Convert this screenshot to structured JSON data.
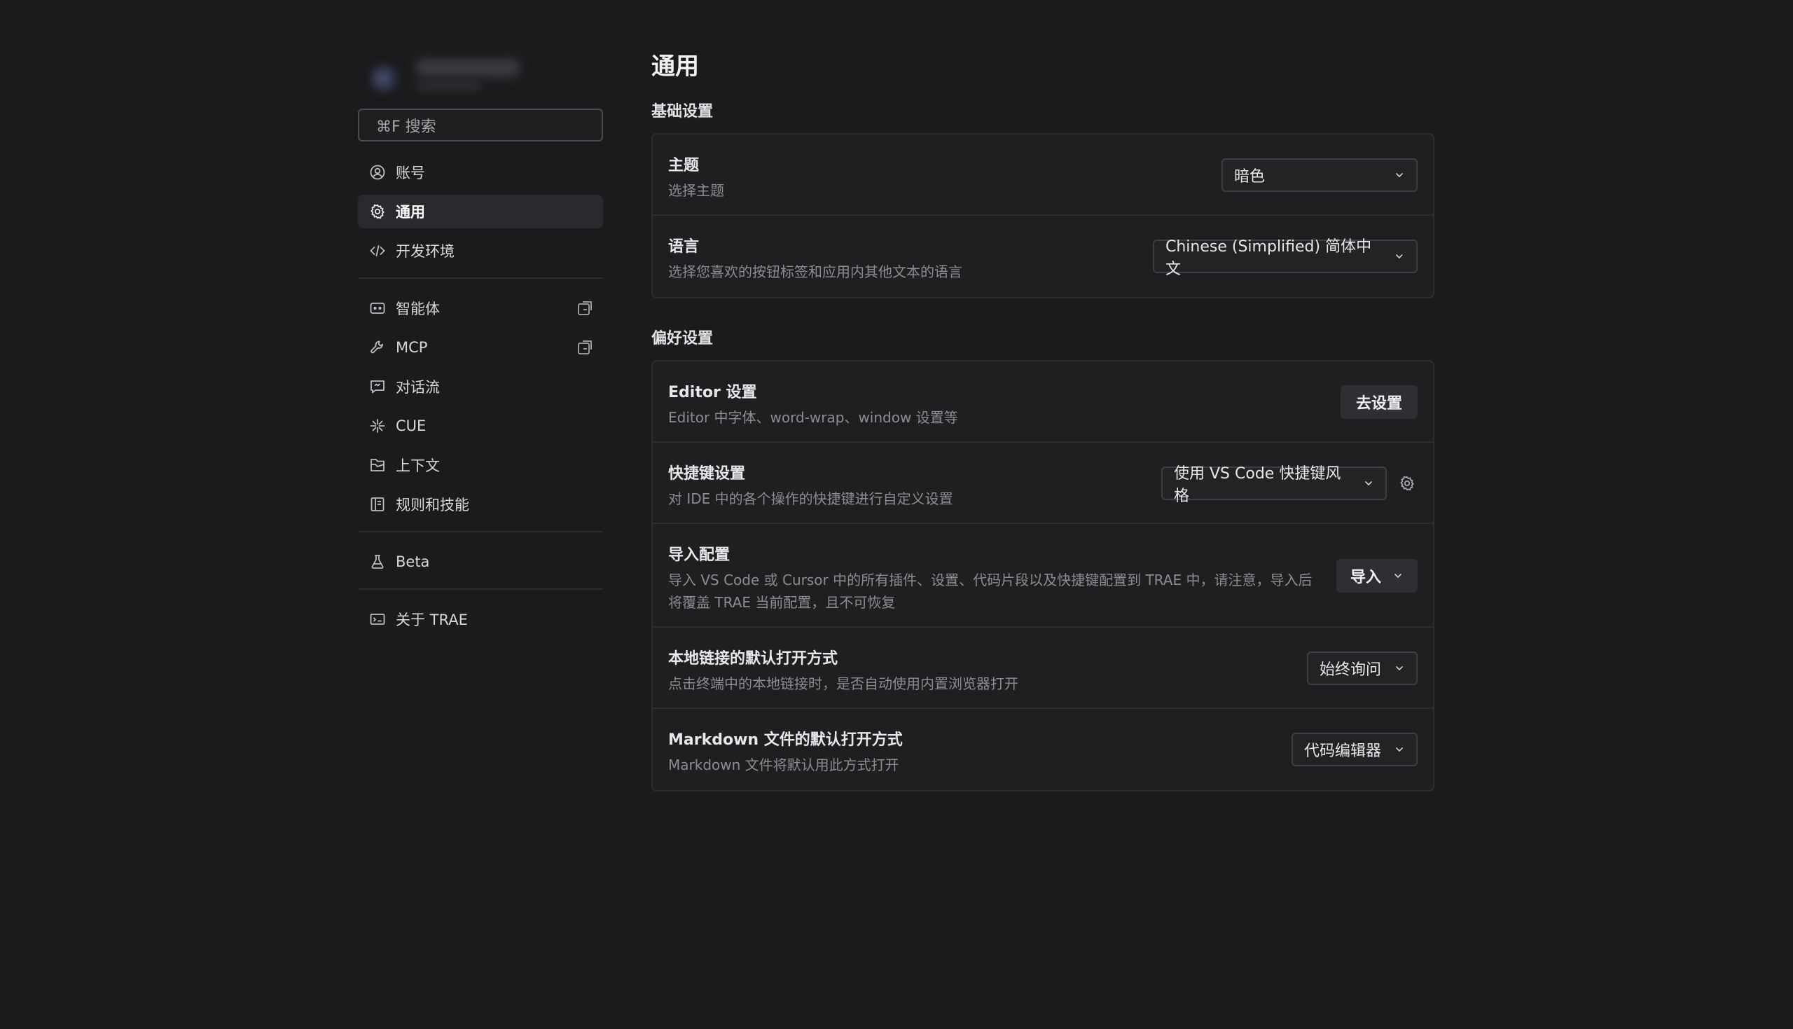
{
  "sidebar": {
    "search": {
      "label": "⌘F 搜索"
    },
    "items": [
      {
        "label": "账号",
        "icon": "user-circle-icon"
      },
      {
        "label": "通用",
        "icon": "gear-icon",
        "active": true
      },
      {
        "label": "开发环境",
        "icon": "code-icon"
      },
      {
        "label": "智能体",
        "icon": "bot-icon",
        "external": true
      },
      {
        "label": "MCP",
        "icon": "wrench-icon",
        "external": true
      },
      {
        "label": "对话流",
        "icon": "chat-icon"
      },
      {
        "label": "CUE",
        "icon": "sparkle-icon"
      },
      {
        "label": "上下文",
        "icon": "folder-icon"
      },
      {
        "label": "规则和技能",
        "icon": "book-icon"
      },
      {
        "label": "Beta",
        "icon": "flask-icon"
      },
      {
        "label": "关于 TRAE",
        "icon": "trae-logo-icon"
      }
    ]
  },
  "main": {
    "title": "通用",
    "basic": {
      "title": "基础设置",
      "theme": {
        "title": "主题",
        "desc": "选择主题",
        "value": "暗色"
      },
      "language": {
        "title": "语言",
        "desc": "选择您喜欢的按钮标签和应用内其他文本的语言",
        "value": "Chinese (Simplified) 简体中文"
      }
    },
    "prefs": {
      "title": "偏好设置",
      "editor": {
        "title": "Editor 设置",
        "desc": "Editor 中字体、word-wrap、window 设置等",
        "button": "去设置"
      },
      "keybind": {
        "title": "快捷键设置",
        "desc": "对 IDE 中的各个操作的快捷键进行自定义设置",
        "value": "使用 VS Code 快捷键风格"
      },
      "import": {
        "title": "导入配置",
        "desc": "导入 VS Code 或 Cursor 中的所有插件、设置、代码片段以及快捷键配置到 TRAE 中，请注意，导入后将覆盖 TRAE 当前配置，且不可恢复",
        "button": "导入"
      },
      "local_link": {
        "title": "本地链接的默认打开方式",
        "desc": "点击终端中的本地链接时，是否自动使用内置浏览器打开",
        "value": "始终询问"
      },
      "markdown": {
        "title": "Markdown 文件的默认打开方式",
        "desc": "Markdown 文件将默认用此方式打开",
        "value": "代码编辑器"
      }
    }
  }
}
